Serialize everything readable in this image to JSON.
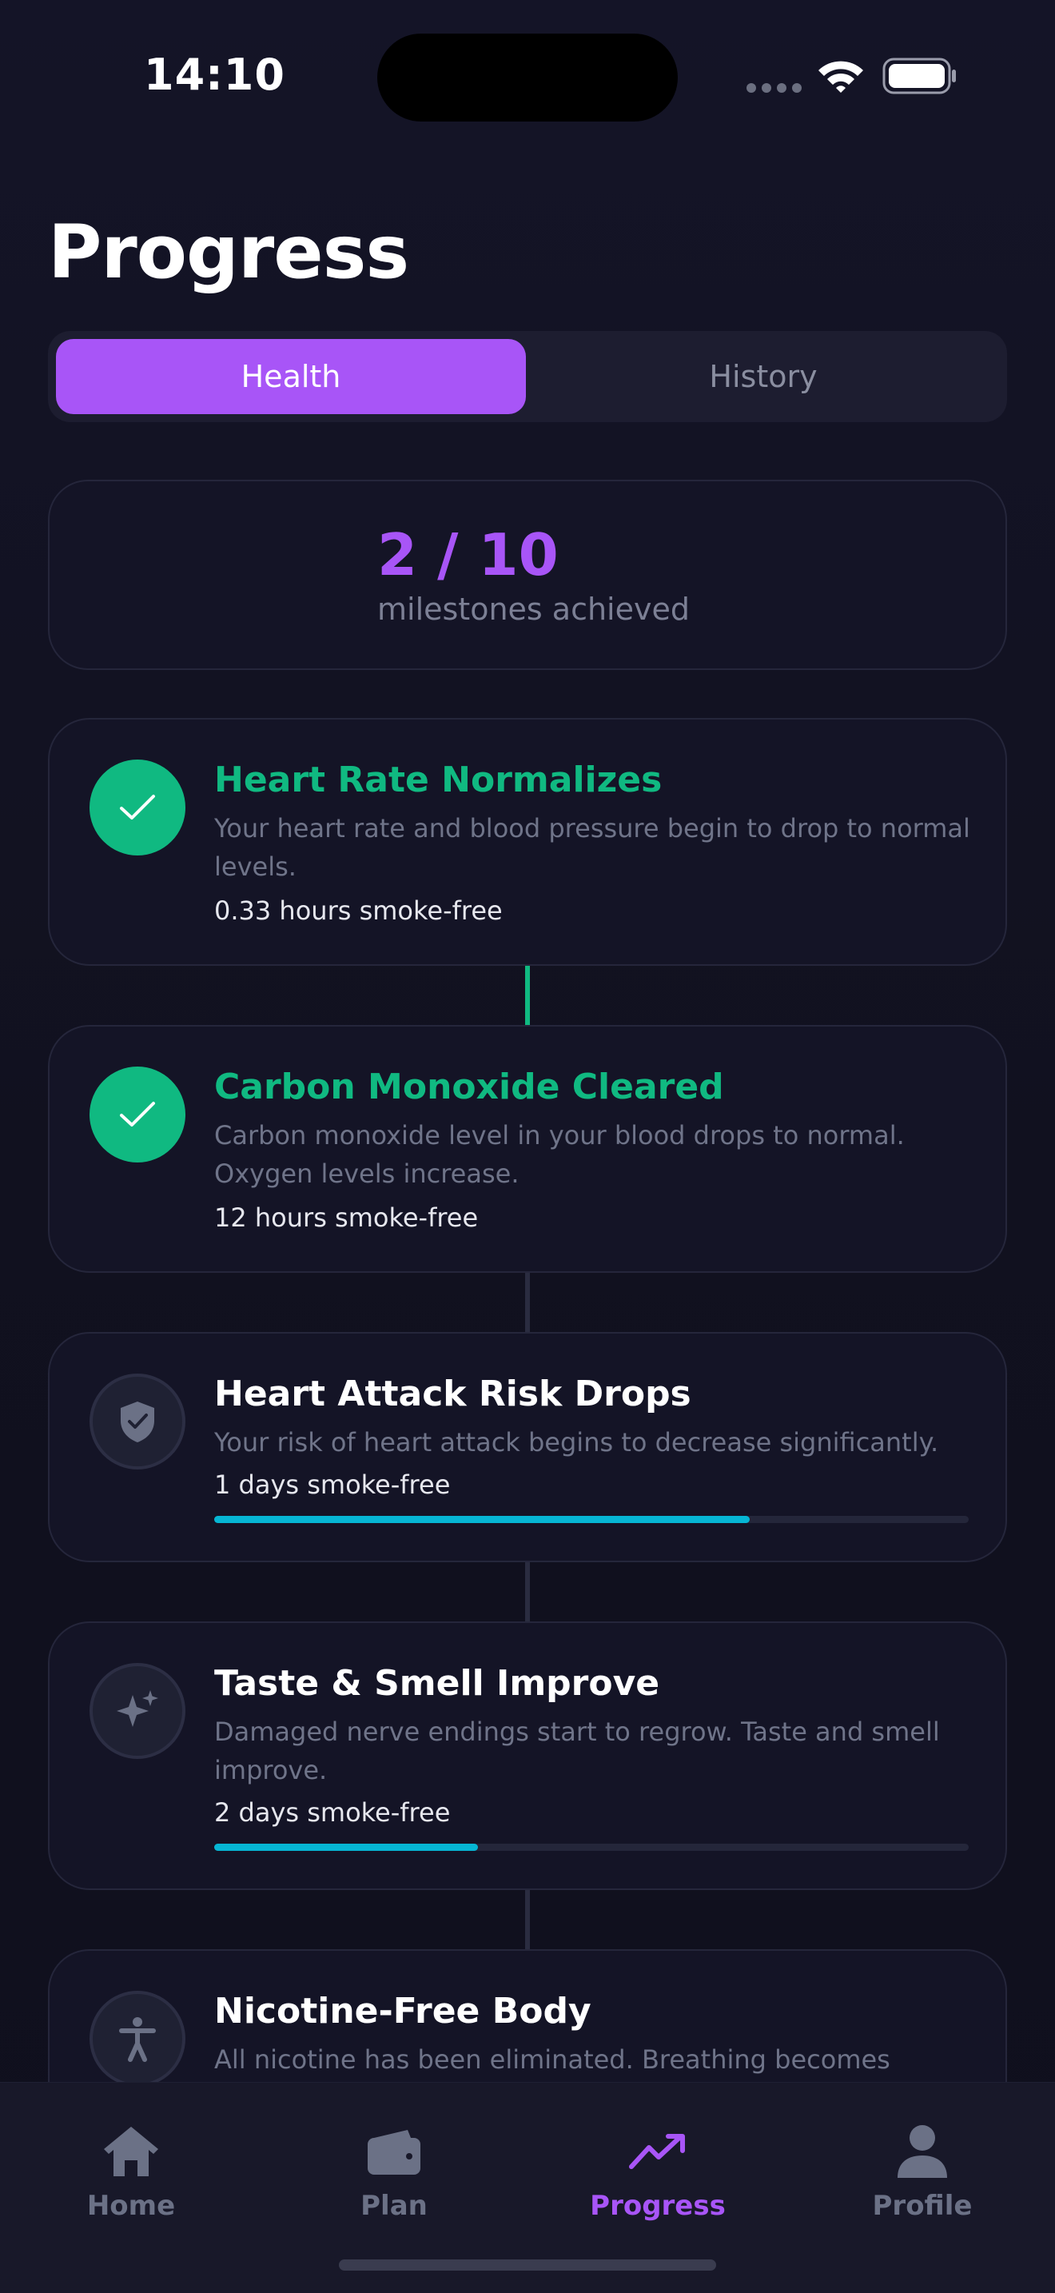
{
  "status_bar": {
    "time": "14:10"
  },
  "header": {
    "title": "Progress"
  },
  "segments": {
    "health": "Health",
    "history": "History"
  },
  "summary": {
    "count": "2 / 10",
    "label": "milestones achieved"
  },
  "milestones": [
    {
      "title": "Heart Rate Normalizes",
      "description": "Your heart rate and blood pressure begin to drop to normal levels.",
      "time": "0.33 hours smoke-free",
      "status": "achieved",
      "icon": "check-icon"
    },
    {
      "title": "Carbon Monoxide Cleared",
      "description": "Carbon monoxide level in your blood drops to normal. Oxygen levels increase.",
      "time": "12 hours smoke-free",
      "status": "achieved",
      "icon": "check-icon"
    },
    {
      "title": "Heart Attack Risk Drops",
      "description": "Your risk of heart attack begins to decrease significantly.",
      "time": "1 days smoke-free",
      "status": "in-progress",
      "progress": 0.71,
      "icon": "shield-icon"
    },
    {
      "title": "Taste & Smell Improve",
      "description": "Damaged nerve endings start to regrow. Taste and smell improve.",
      "time": "2 days smoke-free",
      "status": "in-progress",
      "progress": 0.35,
      "icon": "sparkles-icon"
    },
    {
      "title": "Nicotine-Free Body",
      "description": "All nicotine has been eliminated. Breathing becomes easier.",
      "status": "in-progress",
      "icon": "person-icon"
    }
  ],
  "tabbar": {
    "home": "Home",
    "plan": "Plan",
    "progress": "Progress",
    "profile": "Profile"
  },
  "colors": {
    "accent": "#a855f7",
    "achieved": "#10b981",
    "progress": "#06b6d4",
    "background": "#11111f"
  }
}
